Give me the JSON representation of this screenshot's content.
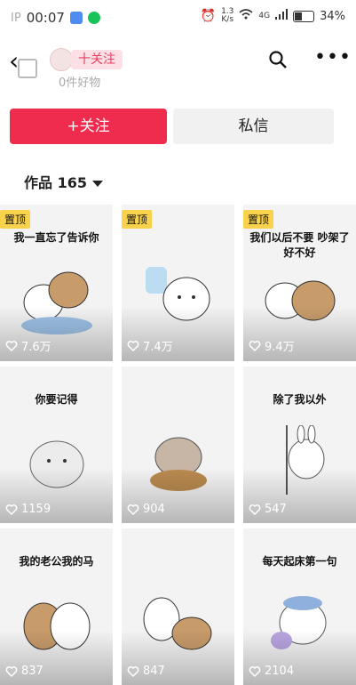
{
  "status": {
    "ip": "IP",
    "time": "00:07",
    "speed_top": "1.3",
    "speed_unit": "K/s",
    "network": "4G",
    "battery": "34%"
  },
  "profile": {
    "goods": "0件好物",
    "follow_pill": "十关注"
  },
  "actions": {
    "follow": "+关注",
    "message": "私信"
  },
  "works": {
    "label": "作品 165"
  },
  "posts": [
    {
      "pinned": "置顶",
      "caption": "我一直忘了告诉你",
      "likes": "7.6万"
    },
    {
      "pinned": "置顶",
      "caption": "",
      "likes": "7.4万"
    },
    {
      "pinned": "置顶",
      "caption": "我们以后不要 吵架了好不好",
      "likes": "9.4万"
    },
    {
      "pinned": "",
      "caption": "你要记得",
      "likes": "1159"
    },
    {
      "pinned": "",
      "caption": "",
      "likes": "904"
    },
    {
      "pinned": "",
      "caption": "除了我以外",
      "likes": "547"
    },
    {
      "pinned": "",
      "caption": "我的老公我的马",
      "likes": "837"
    },
    {
      "pinned": "",
      "caption": "",
      "likes": "847"
    },
    {
      "pinned": "",
      "caption": "每天起床第一句",
      "likes": "2104"
    }
  ],
  "colors": {
    "brand": "#f02c4e",
    "pin": "#f8d24a",
    "pill_bg": "#fde0e6"
  }
}
